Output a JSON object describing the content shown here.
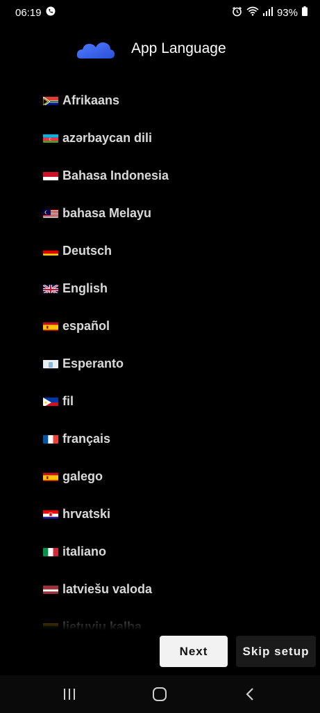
{
  "status": {
    "time": "06:19",
    "battery": "93%"
  },
  "header": {
    "title": "App Language"
  },
  "languages": [
    {
      "label": "Afrikaans",
      "flag": "za"
    },
    {
      "label": "azərbaycan dili",
      "flag": "az"
    },
    {
      "label": "Bahasa Indonesia",
      "flag": "id"
    },
    {
      "label": "bahasa Melayu",
      "flag": "my"
    },
    {
      "label": "Deutsch",
      "flag": "de"
    },
    {
      "label": "English",
      "flag": "gb"
    },
    {
      "label": "español",
      "flag": "es"
    },
    {
      "label": "Esperanto",
      "flag": "eo"
    },
    {
      "label": "fil",
      "flag": "ph"
    },
    {
      "label": "français",
      "flag": "fr"
    },
    {
      "label": "galego",
      "flag": "es"
    },
    {
      "label": "hrvatski",
      "flag": "hr"
    },
    {
      "label": "italiano",
      "flag": "it"
    },
    {
      "label": "latviešu valoda",
      "flag": "lv"
    },
    {
      "label": "lietuvių kalba",
      "flag": "lt"
    }
  ],
  "buttons": {
    "next": "Next",
    "skip": "Skip setup"
  },
  "colors": {
    "cloud": "#3b6bff",
    "background": "#000000"
  }
}
